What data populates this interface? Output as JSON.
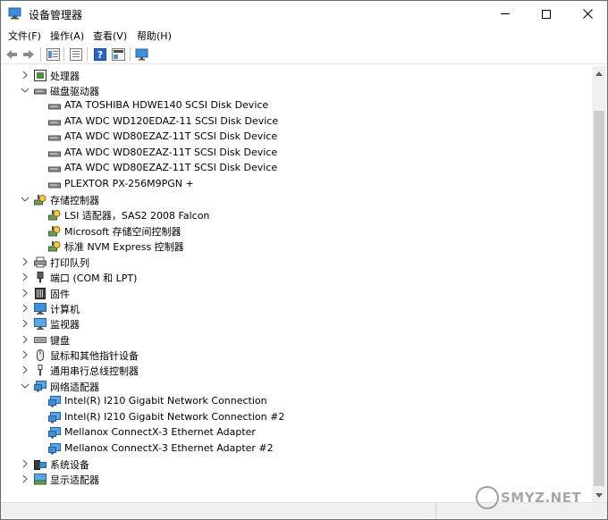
{
  "window": {
    "title": "设备管理器"
  },
  "menu": [
    {
      "name": "menu-file",
      "label": "文件(F)"
    },
    {
      "name": "menu-action",
      "label": "操作(A)"
    },
    {
      "name": "menu-view",
      "label": "查看(V)"
    },
    {
      "name": "menu-help",
      "label": "帮助(H)"
    }
  ],
  "toolbar": {
    "icons": [
      "back-arrow-icon",
      "forward-arrow-icon",
      "properties-icon",
      "list-view-icon",
      "help-icon",
      "show-hide-icon",
      "monitor-icon"
    ]
  },
  "tree": {
    "cat_processor": "处理器",
    "cat_disk": "磁盘驱动器",
    "disk_items": [
      "ATA TOSHIBA HDWE140 SCSI Disk Device",
      "ATA WDC WD120EDAZ-11 SCSI Disk Device",
      "ATA WDC WD80EZAZ-11T SCSI Disk Device",
      "ATA WDC WD80EZAZ-11T SCSI Disk Device",
      "ATA WDC WD80EZAZ-11T SCSI Disk Device",
      "PLEXTOR PX-256M9PGN +"
    ],
    "cat_storage": "存储控制器",
    "storage_items": [
      "LSI 适配器，SAS2 2008 Falcon",
      "Microsoft 存储空间控制器",
      "标准 NVM Express 控制器"
    ],
    "cat_print": "打印队列",
    "cat_ports": "端口 (COM 和 LPT)",
    "cat_firmware": "固件",
    "cat_computer": "计算机",
    "cat_monitor": "监视器",
    "cat_keyboard": "键盘",
    "cat_mouse": "鼠标和其他指针设备",
    "cat_usb": "通用串行总线控制器",
    "cat_network": "网络适配器",
    "network_items": [
      "Intel(R) I210 Gigabit Network Connection",
      "Intel(R) I210 Gigabit Network Connection #2",
      "Mellanox ConnectX-3 Ethernet Adapter",
      "Mellanox ConnectX-3 Ethernet Adapter #2"
    ],
    "cat_system": "系统设备",
    "cat_display": "显示适配器"
  },
  "watermark": "SMYZ.NET"
}
